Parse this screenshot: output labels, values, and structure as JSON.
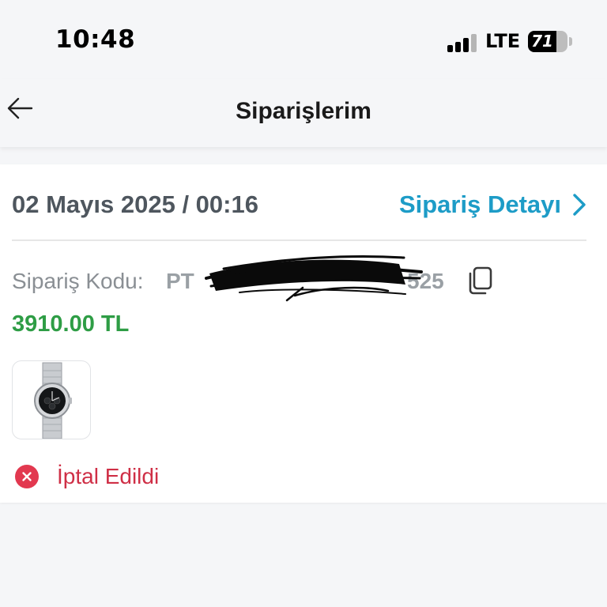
{
  "status_bar": {
    "time": "10:48",
    "network": "LTE",
    "battery": "71",
    "battery_level": 0.71,
    "signal_bars": 4
  },
  "header": {
    "back_icon": "arrow-left-icon",
    "title": "Siparişlerim"
  },
  "order": {
    "date": "02 Mayıs 2025 / 00:16",
    "detail_link": "Sipariş Detayı",
    "detail_icon": "chevron-right-icon",
    "code_label": "Sipariş Kodu:",
    "code_prefix": "PT",
    "code_suffix": "525",
    "copy_icon": "copy-icon",
    "total": "3910.00 TL",
    "product_image": "watch-image",
    "status": "İptal Edildi",
    "status_icon": "cancel-circle-icon"
  },
  "colors": {
    "link": "#1d9cc7",
    "price": "#2e9d45",
    "status_cancelled": "#cf2f46",
    "background": "#f5f6f8"
  }
}
